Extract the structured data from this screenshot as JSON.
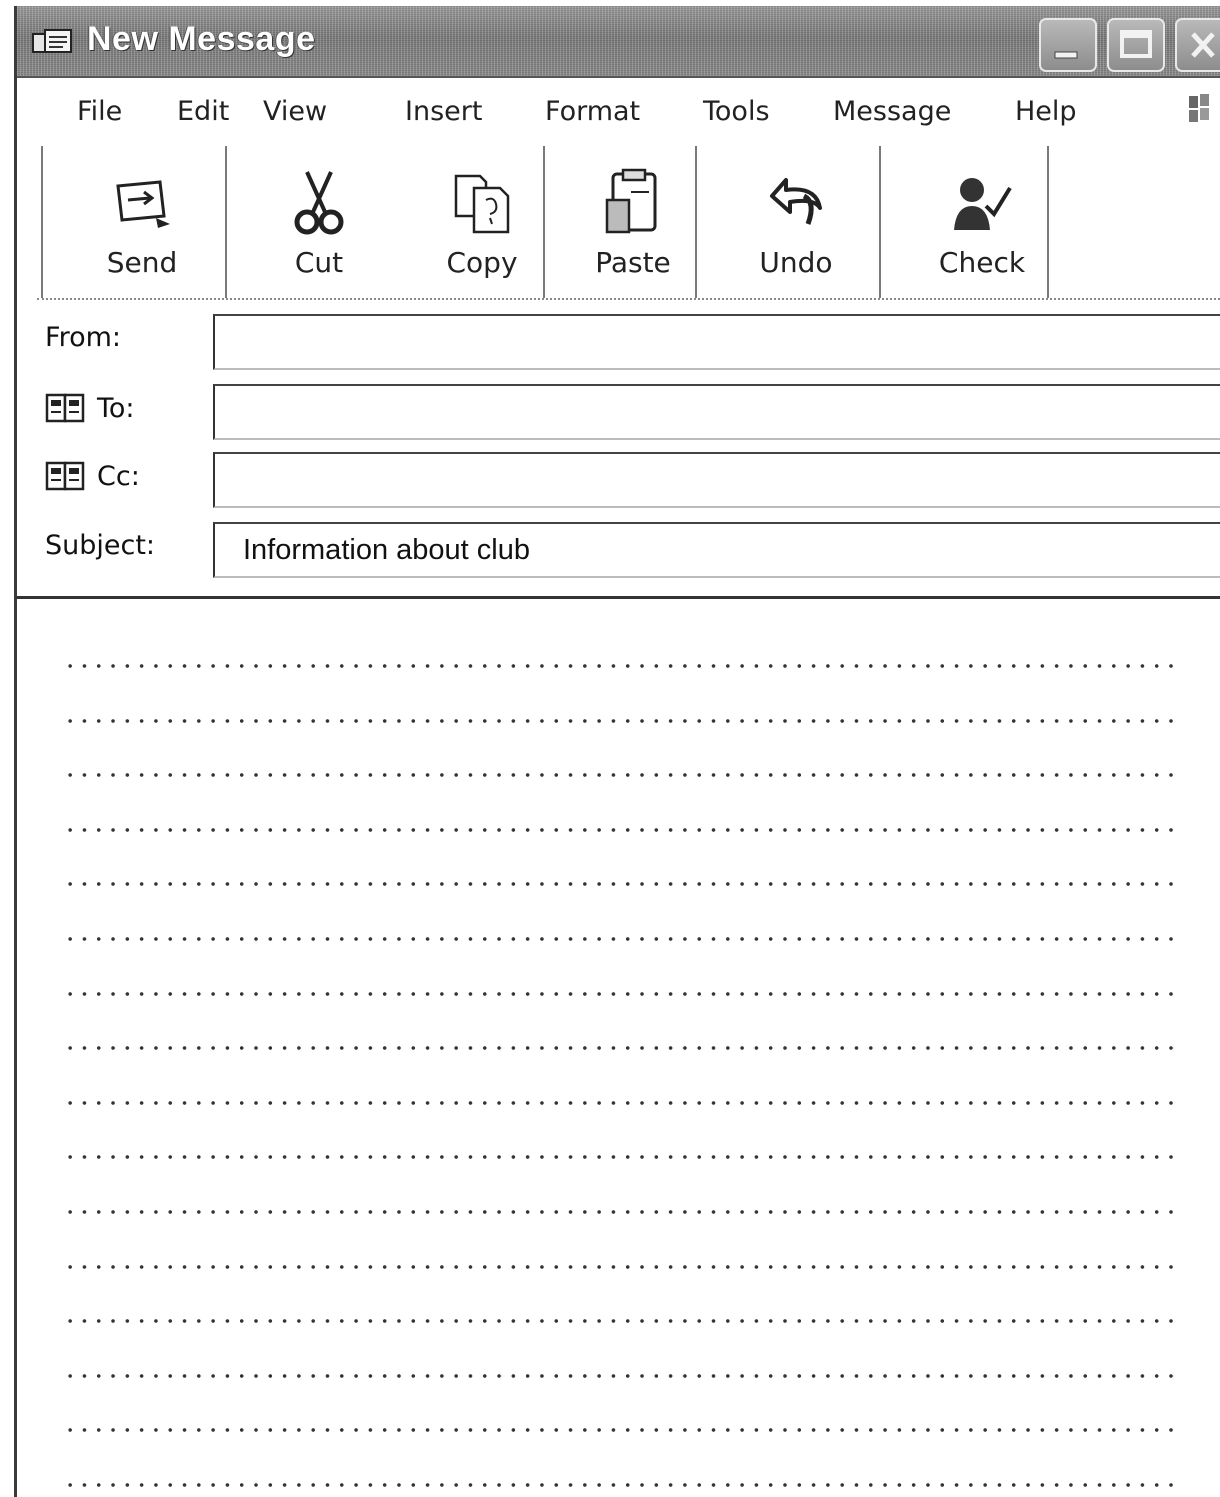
{
  "window": {
    "title": "New Message"
  },
  "menu": {
    "items": [
      "File",
      "Edit",
      "View",
      "Insert",
      "Format",
      "Tools",
      "Message",
      "Help"
    ]
  },
  "toolbar": {
    "send_label": "Send",
    "cut_label": "Cut",
    "copy_label": "Copy",
    "paste_label": "Paste",
    "undo_label": "Undo",
    "check_label": "Check"
  },
  "fields": {
    "from_label": "From:",
    "from_value": "",
    "to_label": "To:",
    "to_value": "",
    "cc_label": "Cc:",
    "cc_value": "",
    "subject_label": "Subject:",
    "subject_value": "Information about club"
  },
  "body": {
    "dotted_line_count": 16
  },
  "colors": {
    "titlebar": "#7a7a7a",
    "title_text": "#ffffff",
    "text": "#222222",
    "dots": "#333333"
  }
}
